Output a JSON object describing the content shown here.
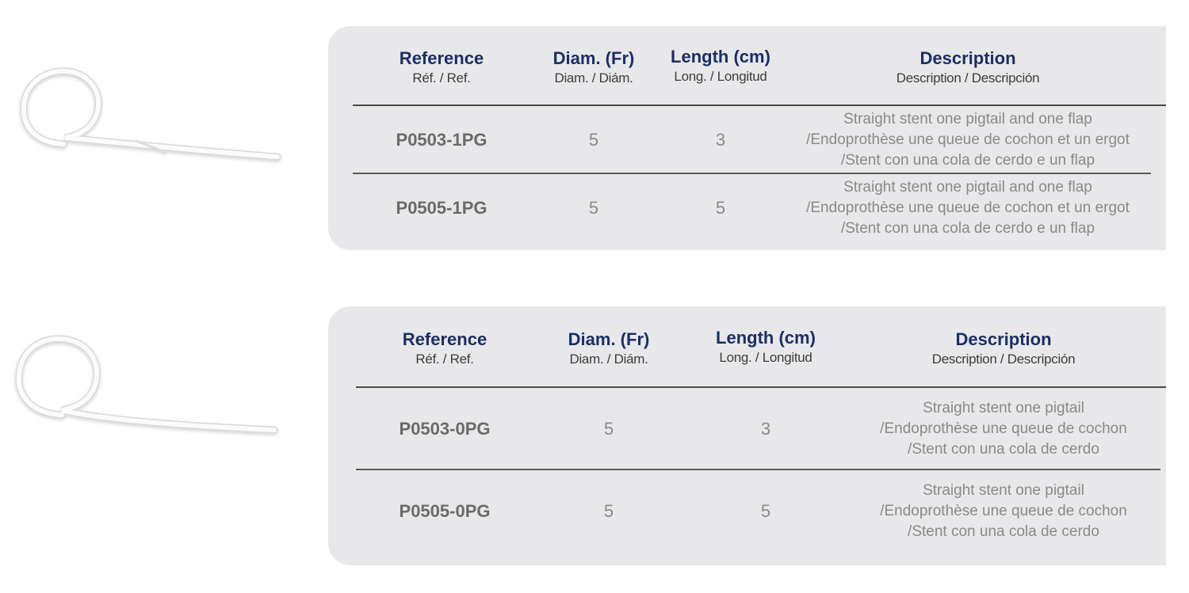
{
  "tables": [
    {
      "headers": {
        "reference": {
          "main": "Reference",
          "sub": "Réf. / Ref."
        },
        "diameter": {
          "main": "Diam. (Fr)",
          "sub": "Diam. / Diám."
        },
        "length": {
          "main": "Length (cm)",
          "sub": "Long. / Longitud"
        },
        "description": {
          "main": "Description",
          "sub": "Description / Descripción"
        }
      },
      "rows": [
        {
          "reference": "P0503-1PG",
          "diameter": "5",
          "length": "3",
          "description": [
            "Straight stent one pigtail and one flap",
            "/Endoprothèse une queue de cochon et un ergot",
            "/Stent con una cola de cerdo e un flap"
          ]
        },
        {
          "reference": "P0505-1PG",
          "diameter": "5",
          "length": "5",
          "description": [
            "Straight stent one pigtail and one flap",
            "/Endoprothèse une queue de cochon et un ergot",
            "/Stent con una cola de cerdo e un flap"
          ]
        }
      ]
    },
    {
      "headers": {
        "reference": {
          "main": "Reference",
          "sub": "Réf. / Ref."
        },
        "diameter": {
          "main": "Diam. (Fr)",
          "sub": "Diam. / Diám."
        },
        "length": {
          "main": "Length (cm)",
          "sub": "Long. / Longitud"
        },
        "description": {
          "main": "Description",
          "sub": "Description / Descripción"
        }
      },
      "rows": [
        {
          "reference": "P0503-0PG",
          "diameter": "5",
          "length": "3",
          "description": [
            "Straight stent one pigtail",
            "/Endoprothèse une queue de cochon",
            "/Stent con una cola de cerdo"
          ]
        },
        {
          "reference": "P0505-0PG",
          "diameter": "5",
          "length": "5",
          "description": [
            "Straight stent one pigtail",
            "/Endoprothèse une queue de cochon",
            "/Stent con una cola de cerdo"
          ]
        }
      ]
    }
  ],
  "colors": {
    "header_text": "#1b2f66",
    "panel_bg": "#e8e8ea",
    "body_text": "#8a8a8a"
  }
}
